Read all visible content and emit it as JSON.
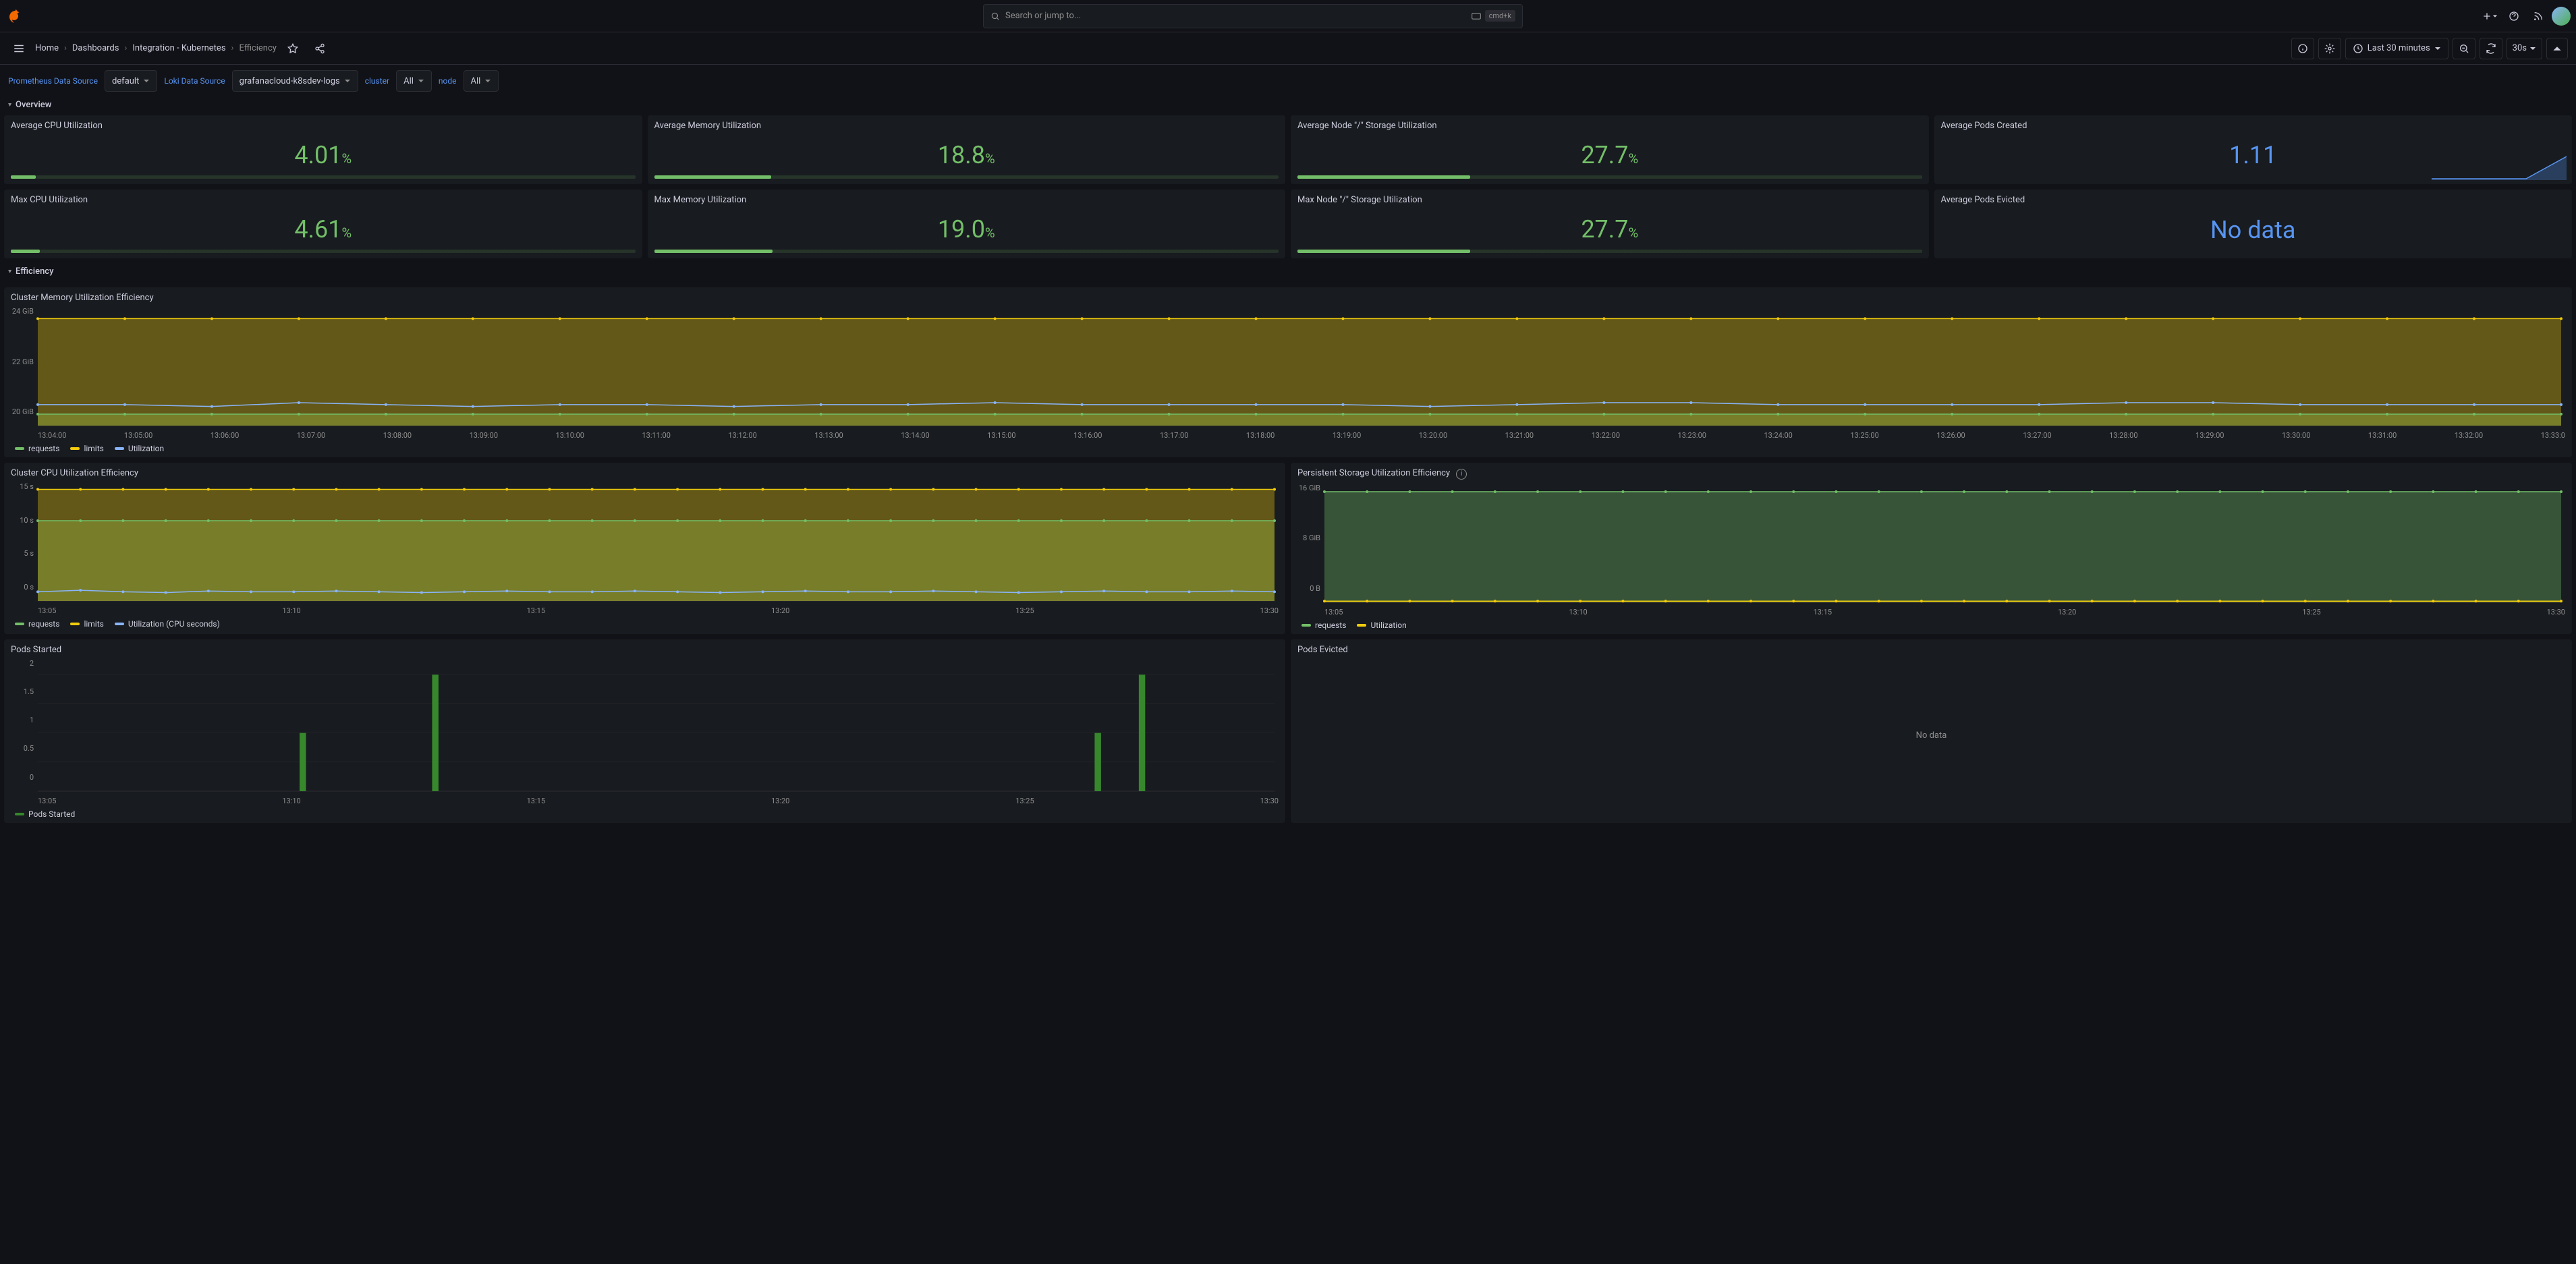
{
  "search": {
    "placeholder": "Search or jump to...",
    "kbd": "cmd+k"
  },
  "breadcrumb": {
    "home": "Home",
    "dashboards": "Dashboards",
    "folder": "Integration - Kubernetes",
    "page": "Efficiency"
  },
  "timerange": {
    "label": "Last 30 minutes",
    "refresh": "30s"
  },
  "vars": {
    "prom_label": "Prometheus Data Source",
    "prom_val": "default",
    "loki_label": "Loki Data Source",
    "loki_val": "grafanacloud-k8sdev-logs",
    "cluster_label": "cluster",
    "cluster_val": "All",
    "node_label": "node",
    "node_val": "All"
  },
  "sections": {
    "overview": "Overview",
    "efficiency": "Efficiency"
  },
  "stats": {
    "avg_cpu": {
      "title": "Average CPU Utilization",
      "value": "4.01",
      "unit": "%",
      "fill": 4.01
    },
    "avg_mem": {
      "title": "Average Memory Utilization",
      "value": "18.8",
      "unit": "%",
      "fill": 18.8
    },
    "avg_storage": {
      "title": "Average Node \"/\" Storage Utilization",
      "value": "27.7",
      "unit": "%",
      "fill": 27.7
    },
    "avg_pods_created": {
      "title": "Average Pods Created",
      "value": "1.11"
    },
    "max_cpu": {
      "title": "Max CPU Utilization",
      "value": "4.61",
      "unit": "%",
      "fill": 4.61
    },
    "max_mem": {
      "title": "Max Memory Utilization",
      "value": "19.0",
      "unit": "%",
      "fill": 19.0
    },
    "max_storage": {
      "title": "Max Node \"/\" Storage Utilization",
      "value": "27.7",
      "unit": "%",
      "fill": 27.7
    },
    "avg_pods_evicted": {
      "title": "Average Pods Evicted",
      "value": "No data"
    }
  },
  "panels": {
    "mem_eff": {
      "title": "Cluster Memory Utilization Efficiency"
    },
    "cpu_eff": {
      "title": "Cluster CPU Utilization Efficiency"
    },
    "storage_eff": {
      "title": "Persistent Storage Utilization Efficiency"
    },
    "pods_started": {
      "title": "Pods Started"
    },
    "pods_evicted": {
      "title": "Pods Evicted",
      "nodata": "No data"
    }
  },
  "legends": {
    "req": "requests",
    "lim": "limits",
    "util": "Utilization",
    "util_cpu": "Utilization (CPU seconds)",
    "pods_started": "Pods Started"
  },
  "colors": {
    "green": "#73bf69",
    "yellow": "#f2cc0c",
    "blue": "#8ab4f8",
    "darkgreen": "#37872d"
  },
  "chart_data": [
    {
      "id": "mem_eff",
      "type": "line",
      "x_ticks": [
        "13:04:00",
        "13:05:00",
        "13:06:00",
        "13:07:00",
        "13:08:00",
        "13:09:00",
        "13:10:00",
        "13:11:00",
        "13:12:00",
        "13:13:00",
        "13:14:00",
        "13:15:00",
        "13:16:00",
        "13:17:00",
        "13:18:00",
        "13:19:00",
        "13:20:00",
        "13:21:00",
        "13:22:00",
        "13:23:00",
        "13:24:00",
        "13:25:00",
        "13:26:00",
        "13:27:00",
        "13:28:00",
        "13:29:00",
        "13:30:00",
        "13:31:00",
        "13:32:00",
        "13:33:0"
      ],
      "y_ticks": [
        "24 GiB",
        "22 GiB",
        "20 GiB"
      ],
      "ylim": [
        19,
        25
      ],
      "series": [
        {
          "name": "requests",
          "color": "#73bf69",
          "values": [
            19.6,
            19.6,
            19.6,
            19.6,
            19.6,
            19.6,
            19.6,
            19.6,
            19.6,
            19.6,
            19.6,
            19.6,
            19.6,
            19.6,
            19.6,
            19.6,
            19.6,
            19.6,
            19.6,
            19.6,
            19.6,
            19.6,
            19.6,
            19.6,
            19.6,
            19.6,
            19.6,
            19.6,
            19.6,
            19.6
          ]
        },
        {
          "name": "limits",
          "color": "#f2cc0c",
          "values": [
            24.6,
            24.6,
            24.6,
            24.6,
            24.6,
            24.6,
            24.6,
            24.6,
            24.6,
            24.6,
            24.6,
            24.6,
            24.6,
            24.6,
            24.6,
            24.6,
            24.6,
            24.6,
            24.6,
            24.6,
            24.6,
            24.6,
            24.6,
            24.6,
            24.6,
            24.6,
            24.6,
            24.6,
            24.6,
            24.6
          ]
        },
        {
          "name": "Utilization",
          "color": "#8ab4f8",
          "values": [
            20.1,
            20.1,
            20.0,
            20.2,
            20.1,
            20.0,
            20.1,
            20.1,
            20.0,
            20.1,
            20.1,
            20.2,
            20.1,
            20.1,
            20.1,
            20.1,
            20.0,
            20.1,
            20.2,
            20.2,
            20.1,
            20.1,
            20.1,
            20.1,
            20.2,
            20.2,
            20.1,
            20.1,
            20.1,
            20.1
          ]
        }
      ]
    },
    {
      "id": "cpu_eff",
      "type": "line",
      "x_ticks": [
        "13:05",
        "13:10",
        "13:15",
        "13:20",
        "13:25",
        "13:30"
      ],
      "y_ticks": [
        "15 s",
        "10 s",
        "5 s",
        "0 s"
      ],
      "ylim": [
        0,
        15
      ],
      "series": [
        {
          "name": "requests",
          "color": "#73bf69",
          "values": [
            10.5,
            10.5,
            10.5,
            10.5,
            10.5,
            10.5,
            10.5,
            10.5,
            10.5,
            10.5,
            10.5,
            10.5,
            10.5,
            10.5,
            10.5,
            10.5,
            10.5,
            10.5,
            10.5,
            10.5,
            10.5,
            10.5,
            10.5,
            10.5,
            10.5,
            10.5,
            10.5,
            10.5,
            10.5,
            10.5
          ]
        },
        {
          "name": "limits",
          "color": "#f2cc0c",
          "values": [
            14.6,
            14.6,
            14.6,
            14.6,
            14.6,
            14.6,
            14.6,
            14.6,
            14.6,
            14.6,
            14.6,
            14.6,
            14.6,
            14.6,
            14.6,
            14.6,
            14.6,
            14.6,
            14.6,
            14.6,
            14.6,
            14.6,
            14.6,
            14.6,
            14.6,
            14.6,
            14.6,
            14.6,
            14.6,
            14.6
          ]
        },
        {
          "name": "Utilization (CPU seconds)",
          "color": "#8ab4f8",
          "values": [
            1.2,
            1.4,
            1.2,
            1.1,
            1.3,
            1.2,
            1.2,
            1.3,
            1.2,
            1.1,
            1.2,
            1.3,
            1.2,
            1.2,
            1.3,
            1.2,
            1.1,
            1.2,
            1.3,
            1.2,
            1.2,
            1.3,
            1.2,
            1.1,
            1.2,
            1.3,
            1.2,
            1.2,
            1.3,
            1.2
          ]
        }
      ]
    },
    {
      "id": "storage_eff",
      "type": "line",
      "x_ticks": [
        "13:05",
        "13:10",
        "13:15",
        "13:20",
        "13:25",
        "13:30"
      ],
      "y_ticks": [
        "16 GiB",
        "8 GiB",
        "0 B"
      ],
      "ylim": [
        0,
        20
      ],
      "series": [
        {
          "name": "requests",
          "color": "#73bf69",
          "values": [
            19.3,
            19.3,
            19.3,
            19.3,
            19.3,
            19.3,
            19.3,
            19.3,
            19.3,
            19.3,
            19.3,
            19.3,
            19.3,
            19.3,
            19.3,
            19.3,
            19.3,
            19.3,
            19.3,
            19.3,
            19.3,
            19.3,
            19.3,
            19.3,
            19.3,
            19.3,
            19.3,
            19.3,
            19.3,
            19.3
          ]
        },
        {
          "name": "Utilization",
          "color": "#f2cc0c",
          "values": [
            0.2,
            0.2,
            0.2,
            0.2,
            0.2,
            0.2,
            0.2,
            0.2,
            0.2,
            0.2,
            0.2,
            0.2,
            0.2,
            0.2,
            0.2,
            0.2,
            0.2,
            0.2,
            0.2,
            0.2,
            0.2,
            0.2,
            0.2,
            0.2,
            0.2,
            0.2,
            0.2,
            0.2,
            0.2,
            0.2
          ]
        }
      ]
    },
    {
      "id": "pods_started",
      "type": "bar",
      "x_ticks": [
        "13:05",
        "13:10",
        "13:15",
        "13:20",
        "13:25",
        "13:30"
      ],
      "y_ticks": [
        "2",
        "1.5",
        "1",
        "0.5",
        "0"
      ],
      "ylim": [
        0,
        2.2
      ],
      "categories": [
        "13:05",
        "13:06",
        "13:07",
        "13:08",
        "13:09",
        "13:10",
        "13:11",
        "13:12",
        "13:13",
        "13:14",
        "13:15",
        "13:16",
        "13:17",
        "13:18",
        "13:19",
        "13:20",
        "13:21",
        "13:22",
        "13:23",
        "13:24",
        "13:25",
        "13:26",
        "13:27",
        "13:28",
        "13:29",
        "13:30",
        "13:31",
        "13:32",
        "13:33"
      ],
      "values": [
        0,
        0,
        0,
        0,
        0,
        0,
        1,
        0,
        0,
        2,
        0,
        0,
        0,
        0,
        0,
        0,
        0,
        0,
        0,
        0,
        0,
        0,
        0,
        0,
        1,
        2,
        0,
        0,
        0
      ]
    }
  ]
}
